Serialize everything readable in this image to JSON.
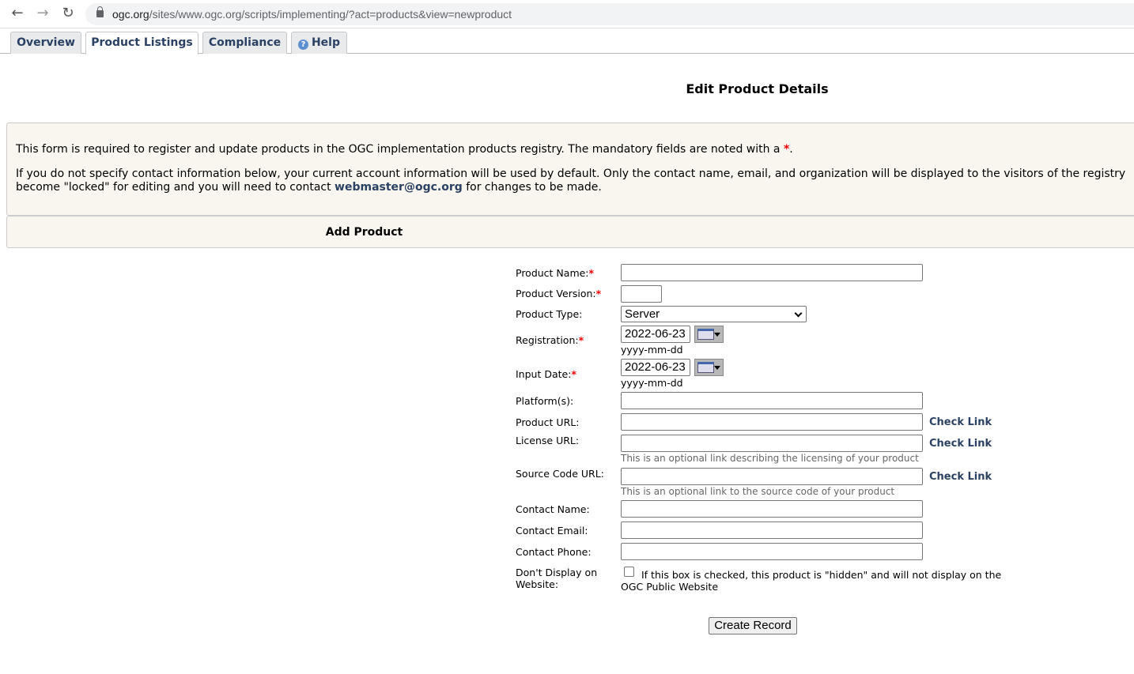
{
  "browser": {
    "url_host": "ogc.org",
    "url_path": "/sites/www.ogc.org/scripts/implementing/?act=products&view=newproduct"
  },
  "tabs": [
    {
      "label": "Overview"
    },
    {
      "label": "Product Listings",
      "active": true
    },
    {
      "label": "Compliance"
    },
    {
      "label": "Help"
    }
  ],
  "page_title": "Edit Product Details",
  "info": {
    "line1": "This form is required to register and update products in the OGC implementation products registry. The mandatory fields are noted with a ",
    "line1_mark": "*",
    "line1_end": ".",
    "line2": "If you do not specify contact information below, your current account information will be used by default. Only the contact name, email, and organization will be displayed to the visitors of the registry",
    "line3_pre": "become \"locked\" for editing and you will need to contact ",
    "email": "webmaster@ogc.org",
    "line3_post": " for changes to be made."
  },
  "section_title": "Add Product",
  "form": {
    "required_mark": "*",
    "product_name": {
      "label": "Product Name:",
      "value": ""
    },
    "product_version": {
      "label": "Product Version:",
      "value": ""
    },
    "product_type": {
      "label": "Product Type:",
      "value": "Server"
    },
    "registration": {
      "label": "Registration:",
      "value": "2022-06-23",
      "format": "yyyy-mm-dd"
    },
    "input_date": {
      "label": "Input Date:",
      "value": "2022-06-23",
      "format": "yyyy-mm-dd"
    },
    "platforms": {
      "label": "Platform(s):",
      "value": ""
    },
    "product_url": {
      "label": "Product URL:",
      "value": ""
    },
    "license_url": {
      "label": "License URL:",
      "value": "",
      "hint": "This is an optional link describing the licensing of your product"
    },
    "source_url": {
      "label": "Source Code URL:",
      "value": "",
      "hint": "This is an optional link to the source code of your product"
    },
    "contact_name": {
      "label": "Contact Name:",
      "value": ""
    },
    "contact_email": {
      "label": "Contact Email:",
      "value": ""
    },
    "contact_phone": {
      "label": "Contact Phone:",
      "value": ""
    },
    "dont_display": {
      "label1": "Don't Display on",
      "label2": "Website:",
      "checked": false,
      "desc1": "If this box is checked, this product is \"hidden\" and will not display on the",
      "desc2": "OGC Public Website"
    },
    "check_link": "Check Link",
    "submit": "Create Record"
  },
  "colors": {
    "tab_text": "#2b4163",
    "required": "#e00000",
    "panel_bg": "#f8f6ee"
  }
}
